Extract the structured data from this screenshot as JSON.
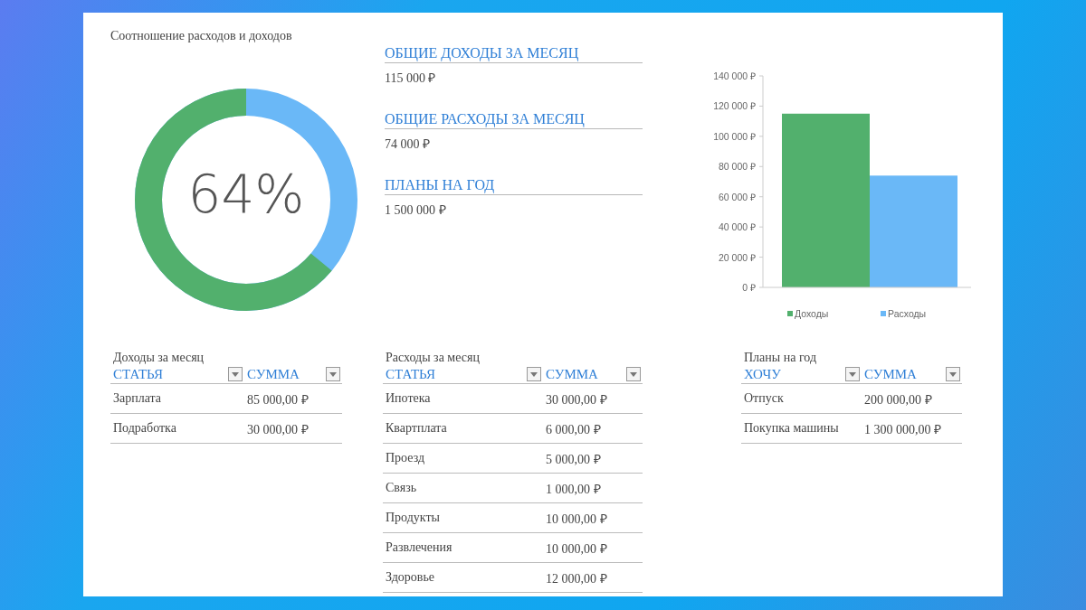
{
  "ratio": {
    "title": "Соотношение расходов и доходов",
    "level": 0.64,
    "reading": "64%"
  },
  "summary": [
    {
      "label": "ОБЩИЕ ДОХОДЫ ЗА МЕСЯЦ",
      "value": "115 000 ₽"
    },
    {
      "label": "ОБЩИЕ РАСХОДЫ ЗА МЕСЯЦ",
      "value": "74 000 ₽"
    },
    {
      "label": "ПЛАНЫ НА ГОД",
      "value": "1 500 000 ₽"
    }
  ],
  "chart": {
    "chart_data": {
      "type": "bar",
      "categories": [
        null
      ],
      "legend": true,
      "series": [
        {
          "name": "Доходы",
          "color": "#52b06d",
          "values": [
            115000
          ]
        },
        {
          "name": "Расходы",
          "color": "#6ab8f7",
          "values": [
            74000
          ]
        }
      ],
      "ylim": [
        0,
        140000
      ],
      "yticks": [
        {
          "value": 0,
          "label": "0 ₽"
        },
        {
          "value": 20000,
          "label": "20 000 ₽"
        },
        {
          "value": 40000,
          "label": "40 000 ₽"
        },
        {
          "value": 60000,
          "label": "60 000 ₽"
        },
        {
          "value": 80000,
          "label": "80 000 ₽"
        },
        {
          "value": 100000,
          "label": "100 000 ₽"
        },
        {
          "value": 120000,
          "label": "120 000 ₽"
        },
        {
          "value": 140000,
          "label": "140 000 ₽"
        }
      ]
    }
  },
  "tables": [
    {
      "title": "Доходы за месяц",
      "columns": [
        "СТАТЬЯ",
        "СУММА"
      ],
      "rows": [
        [
          "Зарплата",
          "85 000,00 ₽"
        ],
        [
          "Подработка",
          "30 000,00 ₽"
        ]
      ]
    },
    {
      "title": "Расходы за месяц",
      "columns": [
        "СТАТЬЯ",
        "СУММА"
      ],
      "rows": [
        [
          "Ипотека",
          "30 000,00 ₽"
        ],
        [
          "Квартплата",
          "6 000,00 ₽"
        ],
        [
          "Проезд",
          "5 000,00 ₽"
        ],
        [
          "Связь",
          "1 000,00 ₽"
        ],
        [
          "Продукты",
          "10 000,00 ₽"
        ],
        [
          "Развлечения",
          "10 000,00 ₽"
        ],
        [
          "Здоровье",
          "12 000,00 ₽"
        ]
      ]
    },
    {
      "title": "Планы на год",
      "columns": [
        "ХОЧУ",
        "СУММА"
      ],
      "rows": [
        [
          "Отпуск",
          "200 000,00 ₽"
        ],
        [
          "Покупка машины",
          "1 300 000,00 ₽"
        ]
      ]
    }
  ]
}
